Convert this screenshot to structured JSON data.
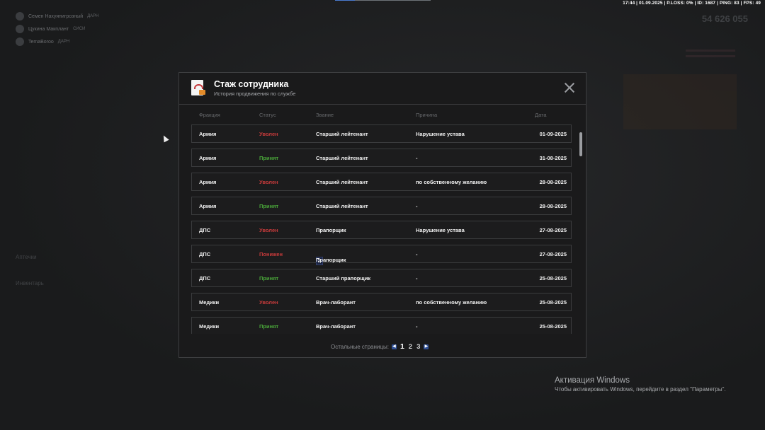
{
  "topbar": {
    "stats": "17:44 | 01.09.2025 | P.LOSS: 0% | ID: 1687 | PING: 83 | FPS: 49"
  },
  "players": [
    {
      "name": "Семен Нахуяпигрозный",
      "tag": "ДАРН"
    },
    {
      "name": "Цукина Макплант",
      "tag": "СИСИ"
    },
    {
      "name": "TemaBoroo",
      "tag": "ДАРН"
    }
  ],
  "hud": {
    "money": "54 626 055"
  },
  "left_hud": {
    "item1": "Аптечки",
    "item2": "Инвентарь"
  },
  "windows_activation": {
    "title": "Активация Windows",
    "text": "Чтобы активировать Windows, перейдите в раздел \"Параметры\"."
  },
  "modal": {
    "title": "Стаж сотрудника",
    "subtitle": "История продвижения по службе",
    "columns": {
      "faction": "Фракция",
      "status": "Статус",
      "rank": "Звание",
      "reason": "Причина",
      "date": "Дата"
    },
    "rows": [
      {
        "faction": "Армия",
        "status": "Уволен",
        "rank": "Старший лейтенант",
        "reason": "Нарушение устава",
        "date": "01-09-2025"
      },
      {
        "faction": "Армия",
        "status": "Принят",
        "rank": "Старший лейтенант",
        "reason": "-",
        "date": "31-08-2025"
      },
      {
        "faction": "Армия",
        "status": "Уволен",
        "rank": "Старший лейтенант",
        "reason": "по собственному желанию",
        "date": "28-08-2025"
      },
      {
        "faction": "Армия",
        "status": "Принят",
        "rank": "Старший лейтенант",
        "reason": "-",
        "date": "28-08-2025"
      },
      {
        "faction": "ДПС",
        "status": "Уволен",
        "rank": "Прапорщик",
        "reason": "Нарушение устава",
        "date": "27-08-2025"
      },
      {
        "faction": "ДПС",
        "status": "Понижен",
        "rank": "Прапорщик",
        "reason": "-",
        "date": "27-08-2025"
      },
      {
        "faction": "ДПС",
        "status": "Принят",
        "rank": "Старший прапорщик",
        "reason": "-",
        "date": "25-08-2025"
      },
      {
        "faction": "Медики",
        "status": "Уволен",
        "rank": "Врач-лаборант",
        "reason": "по собственному желанию",
        "date": "25-08-2025"
      },
      {
        "faction": "Медики",
        "status": "Принят",
        "rank": "Врач-лаборант",
        "reason": "-",
        "date": "25-08-2025"
      }
    ],
    "pager": {
      "label": "Остальные страницы:",
      "pages": [
        "1",
        "2",
        "3"
      ],
      "current": "1"
    }
  },
  "colors": {
    "fired": "#c83b3b",
    "hired": "#4aa83a",
    "demoted": "#c83b3b",
    "accent": "#2f4f95"
  }
}
